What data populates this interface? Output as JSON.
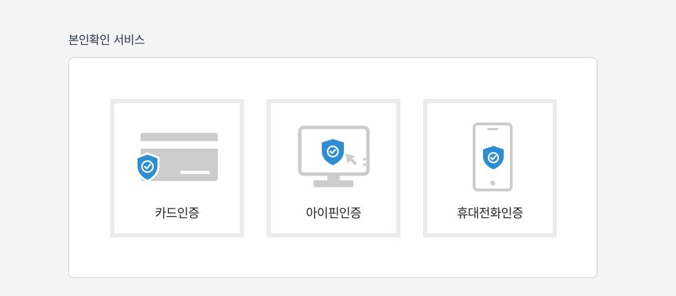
{
  "section": {
    "title": "본인확인 서비스"
  },
  "options": [
    {
      "id": "card",
      "label": "카드인증",
      "icon": "credit-card-shield-icon"
    },
    {
      "id": "ipin",
      "label": "아이핀인증",
      "icon": "monitor-shield-icon"
    },
    {
      "id": "phone",
      "label": "휴대전화인증",
      "icon": "mobile-phone-shield-icon"
    }
  ],
  "colors": {
    "accent": "#2e8ed1",
    "icon_gray": "#cccccc",
    "tile_border": "#ebebeb",
    "panel_border": "#cccccc"
  }
}
